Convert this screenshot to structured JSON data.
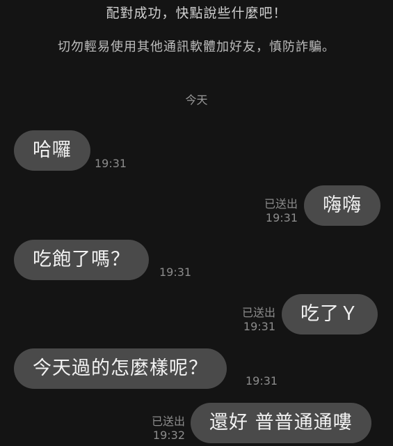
{
  "notices": {
    "matched": "配對成功，快點說些什麼吧！",
    "warning": "切勿輕易使用其他通訊軟體加好友，慎防詐騙。"
  },
  "date_separator": "今天",
  "messages": [
    {
      "side": "left",
      "text": "哈囉",
      "time": "19:31"
    },
    {
      "side": "right",
      "text": "嗨嗨",
      "time": "19:31",
      "status": "已送出"
    },
    {
      "side": "left",
      "text": "吃飽了嗎？",
      "time": "19:31"
    },
    {
      "side": "right",
      "text": "吃了Ｙ",
      "time": "19:31",
      "status": "已送出"
    },
    {
      "side": "left",
      "text": "今天過的怎麼樣呢？",
      "time": "19:31"
    },
    {
      "side": "right",
      "text": "還好 普普通通嘍",
      "time": "19:32",
      "status": "已送出"
    }
  ],
  "colors": {
    "background": "#141414",
    "bubble": "#4a4a4a",
    "meta_text": "#8c8c8c"
  }
}
